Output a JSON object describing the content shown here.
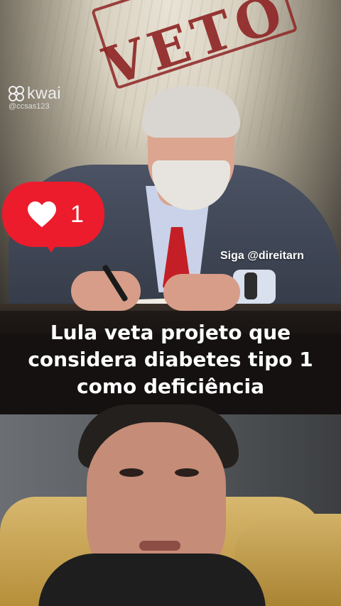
{
  "watermark": {
    "brand": "kwai",
    "username": "@ccsas123"
  },
  "stamp": {
    "text": "VETO"
  },
  "like_badge": {
    "icon": "heart-icon",
    "count": "1",
    "color": "#ec1c2c"
  },
  "follow_text": "Siga @direitarn",
  "caption": {
    "lines": [
      "Lula veta projeto que",
      "considera diabetes tipo 1",
      "como deficiência"
    ]
  }
}
